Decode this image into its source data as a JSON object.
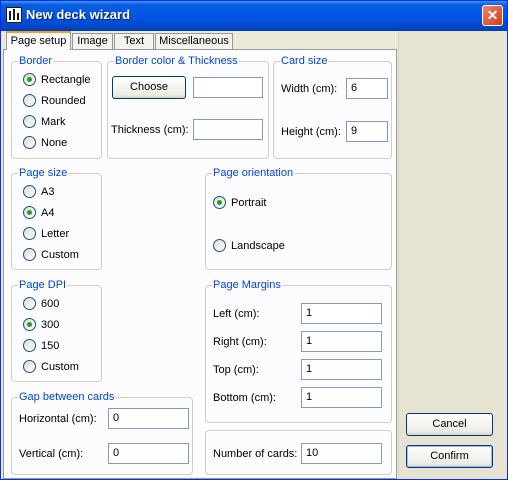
{
  "window": {
    "title": "New deck wizard",
    "close_glyph": "✕"
  },
  "tabs": [
    {
      "label": "Page setup",
      "active": true
    },
    {
      "label": "Image"
    },
    {
      "label": "Text"
    },
    {
      "label": "Miscellaneous"
    }
  ],
  "border": {
    "legend": "Border",
    "options": [
      "Rectangle",
      "Rounded",
      "Mark",
      "None"
    ],
    "selected": "Rectangle"
  },
  "border_color": {
    "legend": "Border color & Thickness",
    "choose_label": "Choose",
    "color_value": "",
    "thickness_label": "Thickness (cm):",
    "thickness_value": ""
  },
  "card_size": {
    "legend": "Card size",
    "width_label": "Width (cm):",
    "width_value": "6",
    "height_label": "Height (cm):",
    "height_value": "9"
  },
  "page_size": {
    "legend": "Page size",
    "options": [
      "A3",
      "A4",
      "Letter",
      "Custom"
    ],
    "selected": "A4"
  },
  "page_orientation": {
    "legend": "Page orientation",
    "options": [
      "Portrait",
      "Landscape"
    ],
    "selected": "Portrait"
  },
  "page_dpi": {
    "legend": "Page DPI",
    "options": [
      "600",
      "300",
      "150",
      "Custom"
    ],
    "selected": "300"
  },
  "page_margins": {
    "legend": "Page Margins",
    "left_label": "Left (cm):",
    "left_value": "1",
    "right_label": "Right (cm):",
    "right_value": "1",
    "top_label": "Top (cm):",
    "top_value": "1",
    "bottom_label": "Bottom (cm):",
    "bottom_value": "1"
  },
  "gap": {
    "legend": "Gap between cards",
    "horizontal_label": "Horizontal (cm):",
    "horizontal_value": "0",
    "vertical_label": "Vertical (cm):",
    "vertical_value": "0"
  },
  "cards": {
    "number_label": "Number of cards:",
    "number_value": "10"
  },
  "actions": {
    "cancel_label": "Cancel",
    "confirm_label": "Confirm"
  },
  "icons": {
    "app": "deck-app-icon",
    "close": "close-icon",
    "radio": "radio-icon"
  },
  "colors": {
    "title_bar": "#0055e5",
    "dialog": "#ece9d8",
    "panel": "#fcfcfe",
    "group_title": "#0046d5",
    "radio_selected": "#21a121",
    "close_button": "#d43b18"
  }
}
